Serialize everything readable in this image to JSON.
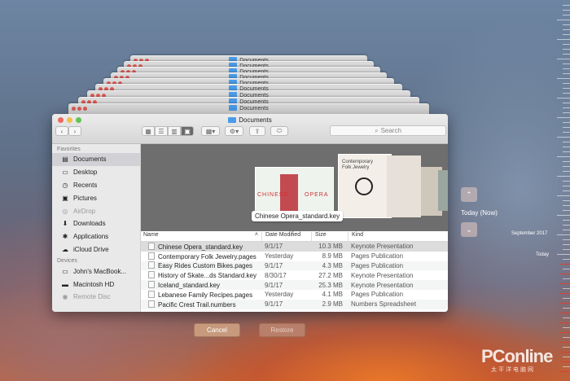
{
  "stack_title": "Documents",
  "window": {
    "title": "Documents",
    "traffic_lights": [
      "#ed6a5e",
      "#f5bf4f",
      "#61c554"
    ],
    "search_placeholder": "Search"
  },
  "sidebar": {
    "favorites_header": "Favorites",
    "favorites": [
      {
        "label": "Documents",
        "icon": "documents-icon",
        "glyph": "▤",
        "selected": true,
        "dim": false
      },
      {
        "label": "Desktop",
        "icon": "desktop-icon",
        "glyph": "▭",
        "selected": false,
        "dim": false
      },
      {
        "label": "Recents",
        "icon": "clock-icon",
        "glyph": "◷",
        "selected": false,
        "dim": false
      },
      {
        "label": "Pictures",
        "icon": "pictures-icon",
        "glyph": "▣",
        "selected": false,
        "dim": false
      },
      {
        "label": "AirDrop",
        "icon": "airdrop-icon",
        "glyph": "◎",
        "selected": false,
        "dim": true
      },
      {
        "label": "Downloads",
        "icon": "downloads-icon",
        "glyph": "⬇",
        "selected": false,
        "dim": false
      },
      {
        "label": "Applications",
        "icon": "applications-icon",
        "glyph": "✱",
        "selected": false,
        "dim": false
      },
      {
        "label": "iCloud Drive",
        "icon": "cloud-icon",
        "glyph": "☁",
        "selected": false,
        "dim": false
      }
    ],
    "devices_header": "Devices",
    "devices": [
      {
        "label": "John's MacBook...",
        "icon": "laptop-icon",
        "glyph": "▭",
        "dim": false
      },
      {
        "label": "Macintosh HD",
        "icon": "disk-icon",
        "glyph": "▬",
        "dim": false
      },
      {
        "label": "Remote Disc",
        "icon": "disc-icon",
        "glyph": "◉",
        "dim": true
      }
    ]
  },
  "gallery": {
    "caption": "Chinese Opera_standard.key",
    "thumb_a_text_left": "CHINESE",
    "thumb_a_text_right": "OPERA",
    "thumb_b_title": "Contemporary Folk Jewelry"
  },
  "file_list": {
    "headers": {
      "name": "Name",
      "date": "Date Modified",
      "size": "Size",
      "kind": "Kind"
    },
    "rows": [
      {
        "name": "Chinese Opera_standard.key",
        "date": "9/1/17",
        "size": "10.3 MB",
        "kind": "Keynote Presentation",
        "selected": true
      },
      {
        "name": "Contemporary Folk Jewelry.pages",
        "date": "Yesterday",
        "size": "8.9 MB",
        "kind": "Pages Publication",
        "selected": false
      },
      {
        "name": "Easy Rides Custom Bikes.pages",
        "date": "9/1/17",
        "size": "4.3 MB",
        "kind": "Pages Publication",
        "selected": false
      },
      {
        "name": "History of Skate...ds Standard.key",
        "date": "8/30/17",
        "size": "27.2 MB",
        "kind": "Keynote Presentation",
        "selected": false
      },
      {
        "name": "Iceland_standard.key",
        "date": "9/1/17",
        "size": "25.3 MB",
        "kind": "Keynote Presentation",
        "selected": false
      },
      {
        "name": "Lebanese Family Recipes.pages",
        "date": "Yesterday",
        "size": "4.1 MB",
        "kind": "Pages Publication",
        "selected": false
      },
      {
        "name": "Pacific Crest Trail.numbers",
        "date": "9/1/17",
        "size": "2.9 MB",
        "kind": "Numbers Spreadsheet",
        "selected": false
      }
    ]
  },
  "buttons": {
    "cancel": "Cancel",
    "restore": "Restore"
  },
  "timeline": {
    "current": "Today (Now)",
    "month_label": "September 2017",
    "today_label": "Today"
  },
  "watermark": {
    "main": "PConline",
    "sub": "太平洋电脑网"
  }
}
